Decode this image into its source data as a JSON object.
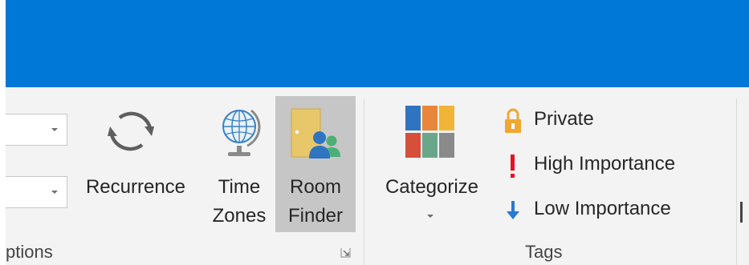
{
  "ribbon": {
    "options_group": {
      "label": "ptions",
      "recurrence_label": "Recurrence",
      "time_zones_label_line1": "Time",
      "time_zones_label_line2": "Zones",
      "room_finder_label_line1": "Room",
      "room_finder_label_line2": "Finder"
    },
    "tags_group": {
      "label": "Tags",
      "categorize_label": "Categorize",
      "private_label": "Private",
      "high_importance_label": "High Importance",
      "low_importance_label": "Low Importance"
    }
  },
  "icons": {
    "recurrence": "recurrence-icon",
    "time_zones": "globe-icon",
    "room_finder": "room-finder-icon",
    "categorize": "categorize-icon",
    "private": "lock-icon",
    "high_importance": "exclamation-icon",
    "low_importance": "down-arrow-icon"
  },
  "colors": {
    "titlebar": "#0078d7",
    "ribbon_bg": "#f3f3f3",
    "selected_button": "#c6c6c6",
    "high_importance": "#e81123",
    "low_importance": "#2b79d0",
    "lock": "#f0a830"
  }
}
